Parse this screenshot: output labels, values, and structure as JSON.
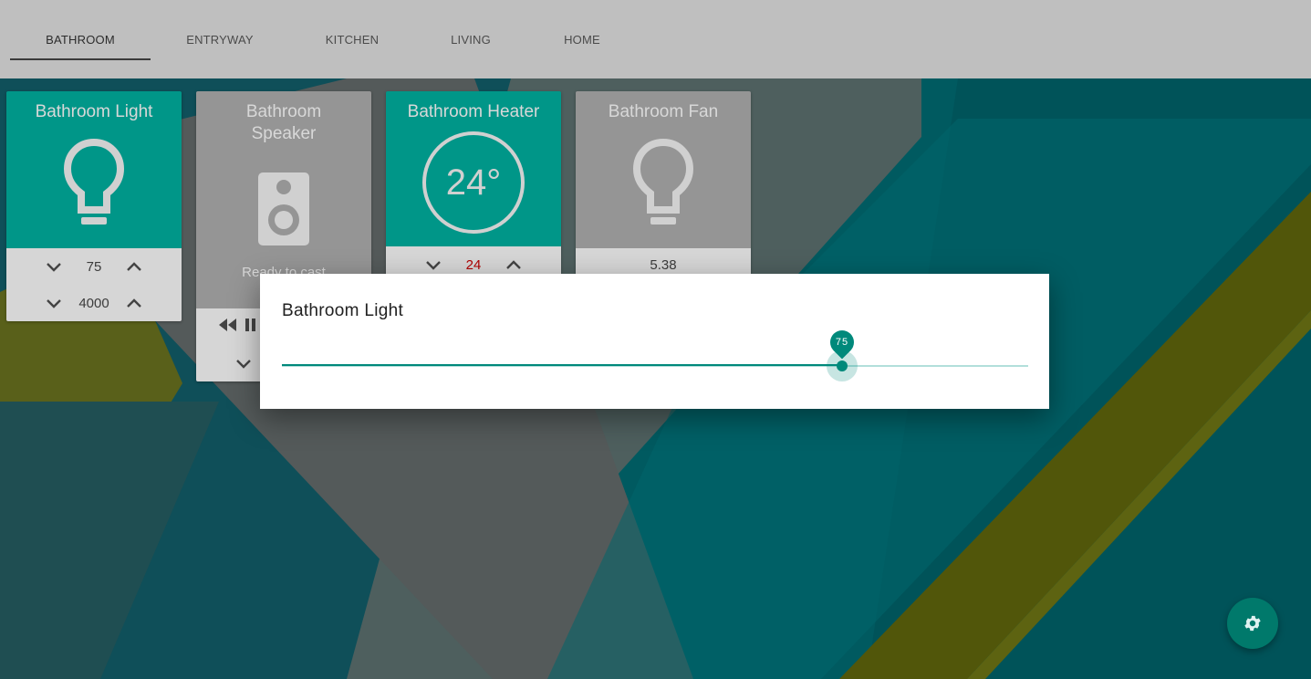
{
  "tabs": [
    {
      "label": "BATHROOM",
      "active": true
    },
    {
      "label": "ENTRYWAY",
      "active": false
    },
    {
      "label": "KITCHEN",
      "active": false
    },
    {
      "label": "LIVING",
      "active": false
    },
    {
      "label": "HOME",
      "active": false
    }
  ],
  "cards": {
    "light": {
      "title": "Bathroom Light",
      "icon": "lightbulb-icon",
      "brightness": "75",
      "color_temp": "4000"
    },
    "speaker": {
      "title": "Bathroom Speaker",
      "icon": "speaker-icon",
      "status": "Ready to cast"
    },
    "heater": {
      "title": "Bathroom Heater",
      "current_temp": "24°",
      "target": "24"
    },
    "fan": {
      "title": "Bathroom Fan",
      "icon": "lightbulb-icon",
      "value": "5.38"
    }
  },
  "dialog": {
    "title": "Bathroom Light",
    "slider": {
      "value": 75,
      "label": "75",
      "min": 0,
      "max": 100
    }
  },
  "fab": {
    "icon": "gear-icon"
  },
  "colors": {
    "teal": "#009688",
    "teal_dark": "#00796b",
    "tabbar": "#bfbfbf",
    "card_gray": "#959595",
    "olive": "#55570a",
    "heater_target": "#b00000"
  }
}
